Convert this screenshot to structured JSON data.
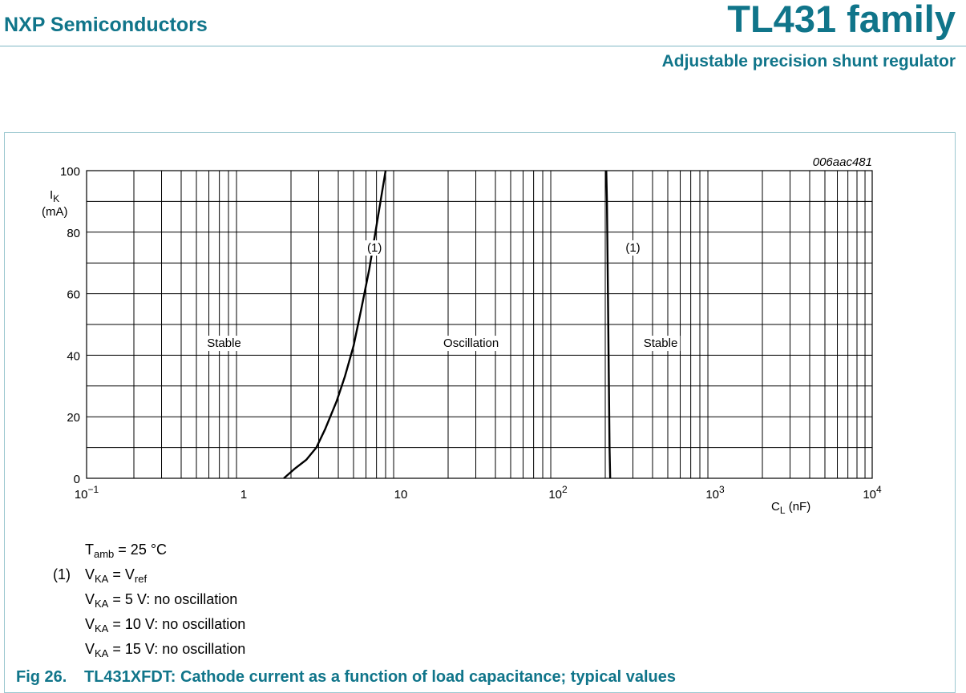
{
  "header": {
    "company": "NXP Semiconductors",
    "title": "TL431 family",
    "subtitle": "Adjustable precision shunt regulator"
  },
  "figure": {
    "code": "006aac481",
    "number": "Fig 26.",
    "caption": "TL431XFDT: Cathode current as a function of load capacitance; typical values"
  },
  "chart_data": {
    "type": "line",
    "x_scale": "log",
    "xlim": [
      0.1,
      10000
    ],
    "ylim": [
      0,
      100
    ],
    "xlabel": "C",
    "xlabel_sub": "L",
    "xlabel_unit": "(nF)",
    "ylabel": "I",
    "ylabel_sub": "K",
    "ylabel_unit": "(mA)",
    "y_ticks": [
      0,
      20,
      40,
      60,
      80,
      100
    ],
    "x_ticks": [
      {
        "value": 0.1,
        "base": "10",
        "exp": "−1"
      },
      {
        "value": 1,
        "base": "1",
        "exp": ""
      },
      {
        "value": 10,
        "base": "10",
        "exp": ""
      },
      {
        "value": 100,
        "base": "10",
        "exp": "2"
      },
      {
        "value": 1000,
        "base": "10",
        "exp": "3"
      },
      {
        "value": 10000,
        "base": "10",
        "exp": "4"
      }
    ],
    "grid": true,
    "series": [
      {
        "name": "(1)",
        "x": [
          1.8,
          2.1,
          2.5,
          2.9,
          3.3,
          3.9,
          4.4,
          5.0,
          5.6,
          6.3,
          7.1,
          8.0
        ],
        "y": [
          0,
          3,
          6,
          10,
          16,
          25,
          33,
          43,
          55,
          68,
          84,
          100
        ]
      },
      {
        "name": "(1)",
        "x": [
          215,
          213,
          212,
          211,
          210,
          209,
          208,
          207,
          206,
          205,
          204,
          203
        ],
        "y": [
          0,
          10,
          20,
          30,
          40,
          50,
          60,
          70,
          80,
          90,
          95,
          100
        ]
      }
    ],
    "series_labels": [
      {
        "text": "(1)",
        "x": 6.8,
        "y": 75
      },
      {
        "text": "(1)",
        "x": 300,
        "y": 75
      }
    ],
    "regions": [
      {
        "text": "Stable",
        "x": 0.75,
        "y": 44
      },
      {
        "text": "Oscillation",
        "x": 28,
        "y": 44
      },
      {
        "text": "Stable",
        "x": 450,
        "y": 44
      }
    ]
  },
  "notes": {
    "tamb": {
      "main": "T",
      "sub": "amb",
      "rest": " = 25 °C"
    },
    "marker": "(1)",
    "lines": [
      {
        "main": "V",
        "sub": "KA",
        "rest": " = V",
        "sub2": "ref",
        "rest2": ""
      },
      {
        "main": "V",
        "sub": "KA",
        "rest": " = 5 V: no oscillation",
        "sub2": "",
        "rest2": ""
      },
      {
        "main": "V",
        "sub": "KA",
        "rest": " = 10 V: no oscillation",
        "sub2": "",
        "rest2": ""
      },
      {
        "main": "V",
        "sub": "KA",
        "rest": " = 15 V: no oscillation",
        "sub2": "",
        "rest2": ""
      }
    ]
  }
}
